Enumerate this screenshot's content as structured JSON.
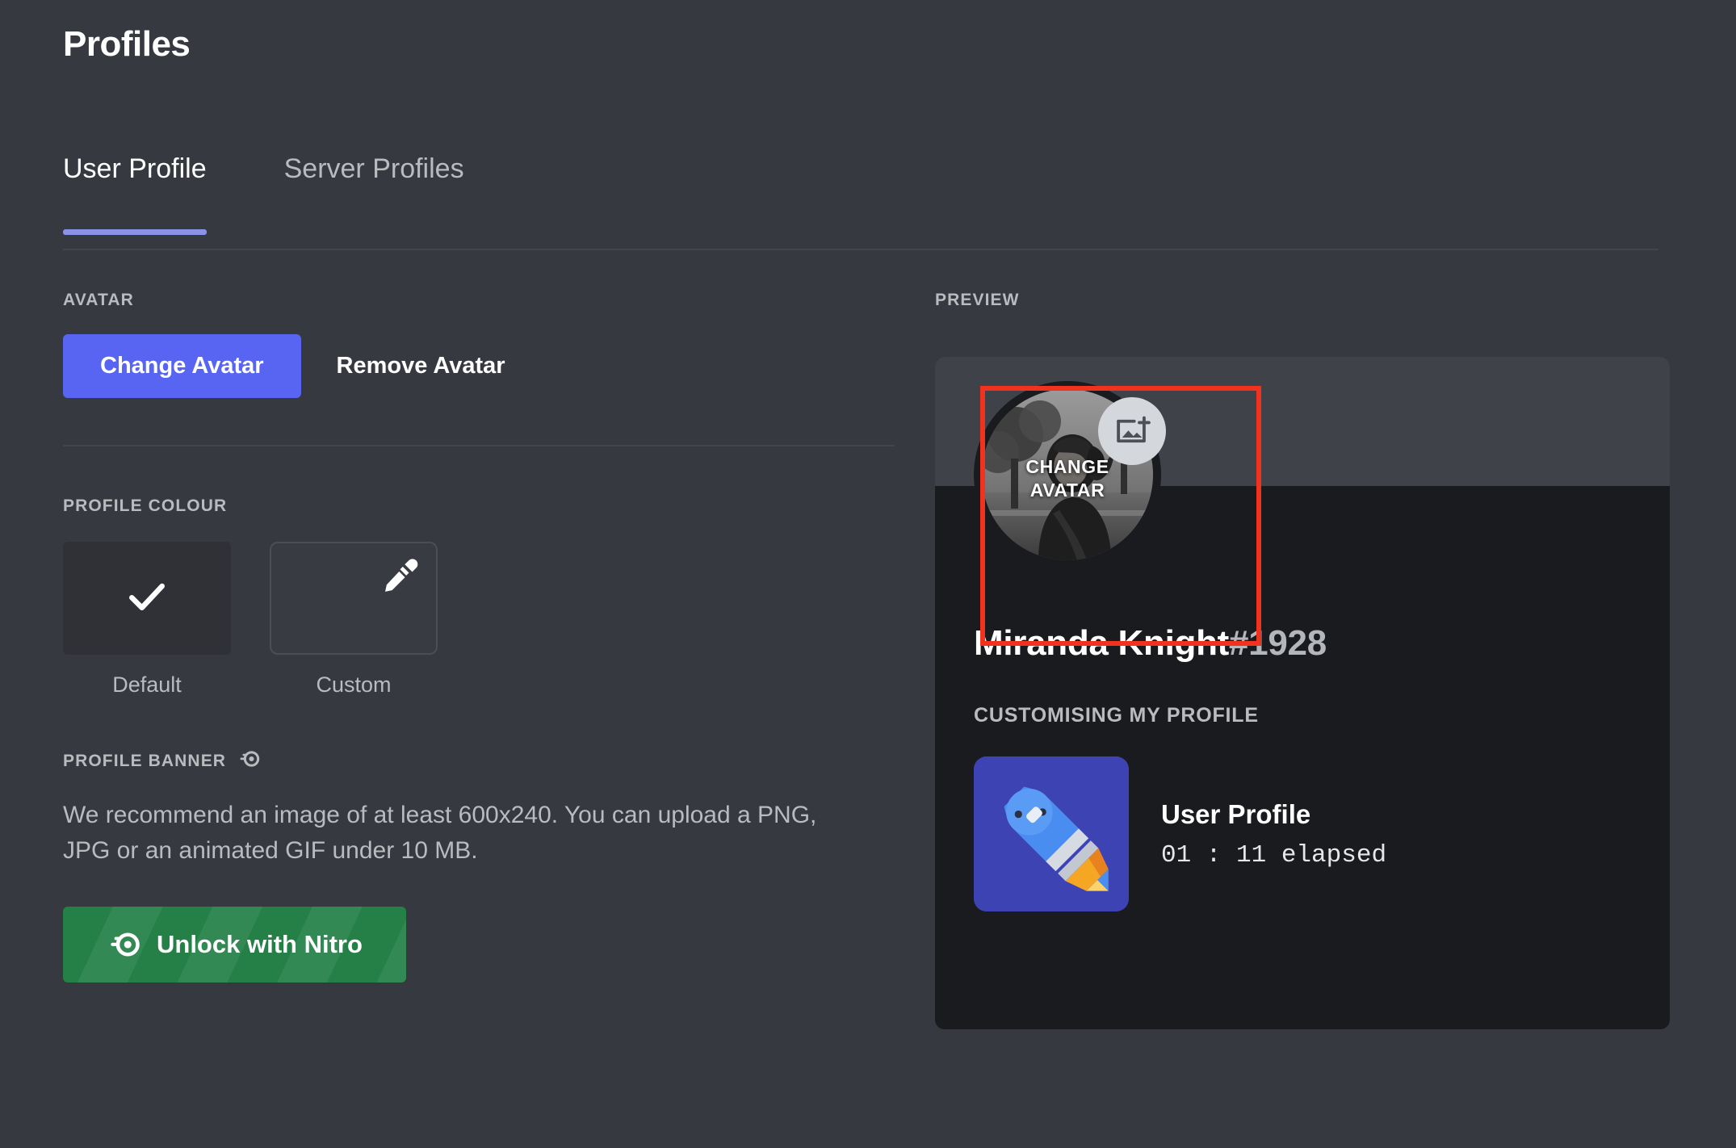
{
  "header": {
    "title": "Profiles"
  },
  "tabs": [
    {
      "label": "User Profile",
      "active": true
    },
    {
      "label": "Server Profiles",
      "active": false
    }
  ],
  "avatar_section": {
    "label": "AVATAR",
    "change_button": "Change Avatar",
    "remove_button": "Remove Avatar"
  },
  "colour_section": {
    "label": "PROFILE COLOUR",
    "swatches": [
      {
        "caption": "Default",
        "selected": true,
        "icon": "check-icon"
      },
      {
        "caption": "Custom",
        "selected": false,
        "icon": "eyedropper-icon"
      }
    ]
  },
  "banner_section": {
    "label": "PROFILE BANNER",
    "badge_icon": "nitro-icon",
    "description": "We recommend an image of at least 600x240. You can upload a PNG, JPG or an animated GIF under 10 MB.",
    "nitro_button": "Unlock with Nitro",
    "nitro_button_icon": "nitro-icon"
  },
  "preview": {
    "label": "PREVIEW",
    "avatar_overlay_line1": "CHANGE",
    "avatar_overlay_line2": "AVATAR",
    "avatar_badge_icon": "add-image-icon",
    "username": "Miranda Knight",
    "discriminator": "#1928",
    "activity_header": "CUSTOMISING MY PROFILE",
    "activity_name": "User Profile",
    "activity_elapsed": "01 : 11 elapsed",
    "activity_icon": "rocket-pencil-icon"
  },
  "colors": {
    "background": "#36393f",
    "accent_blurple": "#5865f2",
    "tab_underline": "#8b92e8",
    "nitro_green": "#248046",
    "highlight_red": "#f0321e",
    "card_background": "#1a1b1e",
    "card_banner": "#3f4248",
    "text_muted": "#b9bbbe"
  }
}
